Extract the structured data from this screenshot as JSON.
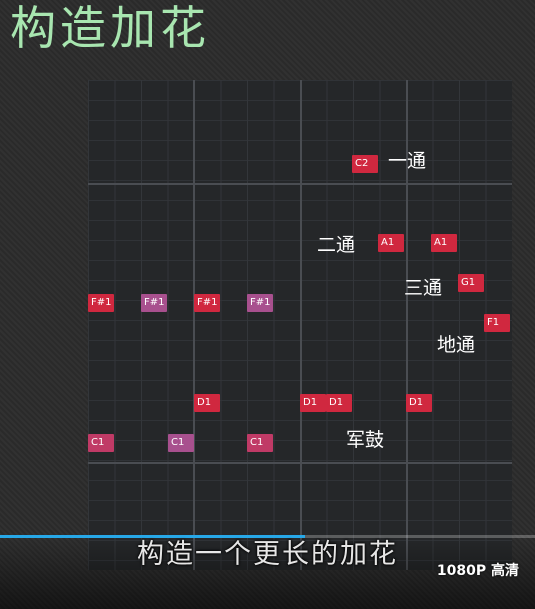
{
  "title": "构造加花",
  "piano_roll": {
    "notes": [
      {
        "name": "C2",
        "color": "red"
      },
      {
        "name": "A1",
        "color": "red"
      },
      {
        "name": "A1",
        "color": "red"
      },
      {
        "name": "G1",
        "color": "red"
      },
      {
        "name": "F1",
        "color": "red"
      },
      {
        "name": "F#1",
        "color": "red"
      },
      {
        "name": "F#1",
        "color": "purple"
      },
      {
        "name": "F#1",
        "color": "red"
      },
      {
        "name": "F#1",
        "color": "purple"
      },
      {
        "name": "D1",
        "color": "red"
      },
      {
        "name": "D1",
        "color": "red"
      },
      {
        "name": "D1",
        "color": "red"
      },
      {
        "name": "D1",
        "color": "red"
      },
      {
        "name": "C1",
        "color": "pink"
      },
      {
        "name": "C1",
        "color": "purple"
      },
      {
        "name": "C1",
        "color": "pink"
      }
    ],
    "labels": {
      "tom1": "一通",
      "tom2": "二通",
      "tom3": "三通",
      "floor_tom": "地通",
      "snare": "军鼓"
    }
  },
  "video": {
    "subtitle": "构造一个更长的加花",
    "quality": "1080P 高清",
    "progress_fraction": 0.57,
    "accent_color": "#27a8e8"
  }
}
